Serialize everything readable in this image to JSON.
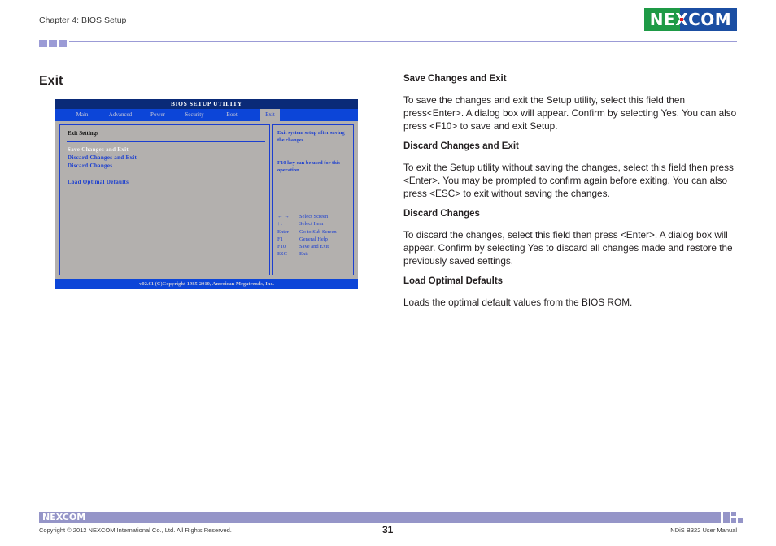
{
  "header": {
    "chapter": "Chapter 4: BIOS Setup",
    "logo_text": {
      "left": "NE",
      "x": "X",
      "right": "COM"
    },
    "accent_color": "#9b9bd6"
  },
  "section_title": "Exit",
  "bios": {
    "title": "BIOS SETUP UTILITY",
    "tabs": [
      {
        "label": "Main",
        "active": false
      },
      {
        "label": "Advanced",
        "active": false
      },
      {
        "label": "Power",
        "active": false
      },
      {
        "label": "Security",
        "active": false
      },
      {
        "label": "Boot",
        "active": false
      },
      {
        "label": "Exit",
        "active": true
      }
    ],
    "panel_heading": "Exit  Settings",
    "items": [
      {
        "label": "Save  Changes  and  Exit",
        "selected": true
      },
      {
        "label": "Discard  Changes  and  Exit",
        "selected": false
      },
      {
        "label": "Discard  Changes",
        "selected": false
      },
      {
        "label": "Load  Optimal  Defaults",
        "selected": false
      }
    ],
    "help": {
      "line1": "Exit system setup after saving the changes.",
      "line2": "F10 key can be used for this operation."
    },
    "keys": [
      {
        "key": "← →",
        "action": "Select Screen"
      },
      {
        "key": "↑↓",
        "action": "Select Item"
      },
      {
        "key": "Enter",
        "action": "Go to Sub Screen"
      },
      {
        "key": "F1",
        "action": "General Help"
      },
      {
        "key": "F10",
        "action": "Save and Exit"
      },
      {
        "key": "ESC",
        "action": "Exit"
      }
    ],
    "footer": "v02.61 (C)Copyright 1985-2010, American Megatrends, Inc."
  },
  "content": [
    {
      "heading": "Save Changes and Exit",
      "body": "To save the changes and exit the Setup utility, select this field then press<Enter>. A dialog box will appear. Confirm by selecting Yes. You can also press <F10> to save and exit Setup."
    },
    {
      "heading": "Discard Changes and Exit",
      "body": "To exit the Setup utility without saving the changes, select this field then press <Enter>. You may be prompted to confirm again before exiting. You can also press <ESC> to exit without saving the changes."
    },
    {
      "heading": "Discard Changes",
      "body": "To discard the changes, select this field then press <Enter>. A dialog box will appear. Confirm by selecting Yes to discard all changes made and restore the previously saved settings."
    },
    {
      "heading": "Load Optimal Defaults",
      "body": "Loads the optimal default values from the BIOS ROM."
    }
  ],
  "footer": {
    "logo_text": "NEXCOM",
    "copyright": "Copyright © 2012 NEXCOM International Co., Ltd. All Rights Reserved.",
    "page_number": "31",
    "manual_name": "NDiS B322 User Manual"
  }
}
